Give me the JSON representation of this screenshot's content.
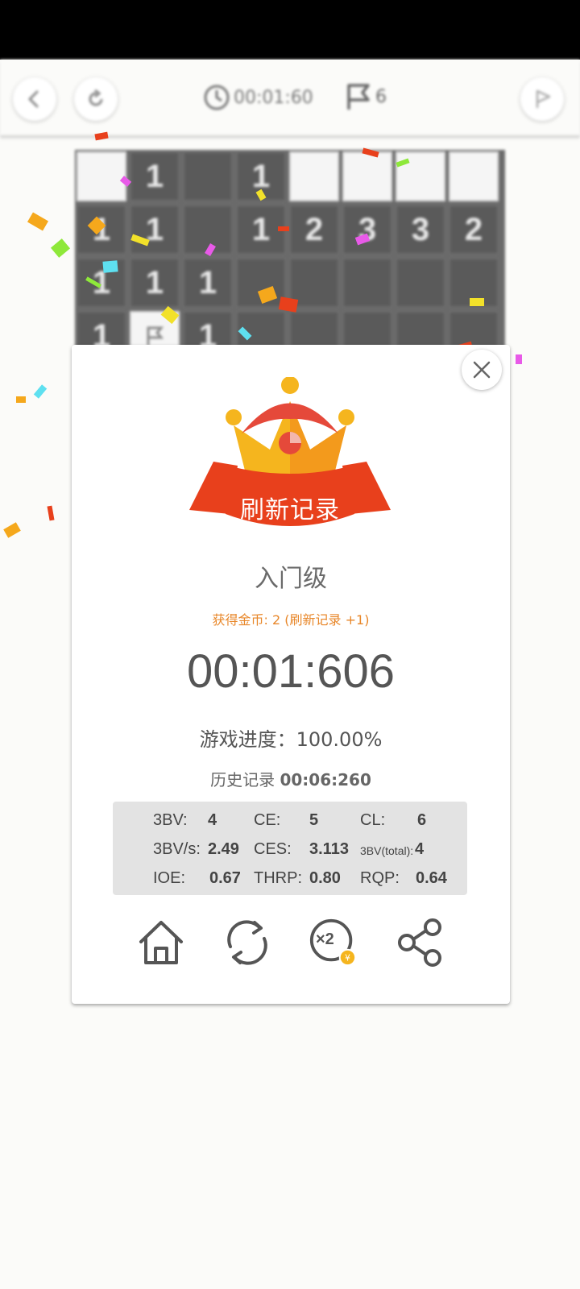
{
  "header": {
    "timer": "00:01:60",
    "flags": "6"
  },
  "board": {
    "rows": [
      [
        "",
        "1",
        "",
        "1",
        "",
        "",
        "",
        ""
      ],
      [
        "1",
        "1",
        "",
        "1",
        "2",
        "3",
        "3",
        "2"
      ],
      [
        "1",
        "1",
        "1",
        "",
        "",
        "",
        "",
        ""
      ],
      [
        "1",
        "flag",
        "1",
        "",
        "",
        "",
        "",
        ""
      ]
    ],
    "open": [
      [
        true,
        false,
        false,
        false,
        true,
        true,
        true,
        true
      ],
      [
        false,
        false,
        false,
        false,
        false,
        false,
        false,
        false
      ],
      [
        false,
        false,
        false,
        false,
        false,
        false,
        false,
        false
      ],
      [
        false,
        true,
        false,
        false,
        false,
        false,
        false,
        false
      ]
    ]
  },
  "dialog": {
    "banner": "刷新记录",
    "level": "入门级",
    "coins": "获得金币: 2 (刷新记录 +1)",
    "time": "00:01:606",
    "progress": "游戏进度：100.00%",
    "history_label": "历史记录",
    "history_value": "00:06:260",
    "stats": {
      "bv_label": "3BV:",
      "bv_value": "4",
      "ce_label": "CE:",
      "ce_value": "5",
      "cl_label": "CL:",
      "cl_value": "6",
      "bvs_label": "3BV/s:",
      "bvs_value": "2.49",
      "ces_label": "CES:",
      "ces_value": "3.113",
      "bvt_label": "3BV(total):",
      "bvt_value": "4",
      "ioe_label": "IOE:",
      "ioe_value": "0.67",
      "thrp_label": "THRP:",
      "thrp_value": "0.80",
      "rqp_label": "RQP:",
      "rqp_value": "0.64"
    },
    "double_badge": "×2"
  },
  "icons": [
    "back-icon",
    "restart-icon",
    "clock-icon",
    "flag-icon",
    "play-icon",
    "close-icon",
    "home-icon",
    "refresh-icon",
    "double-coin-icon",
    "share-icon",
    "crown-icon"
  ],
  "colors": {
    "accent": "#e8872a",
    "banner": "#e8401c",
    "crown_gold": "#f5b51e"
  }
}
